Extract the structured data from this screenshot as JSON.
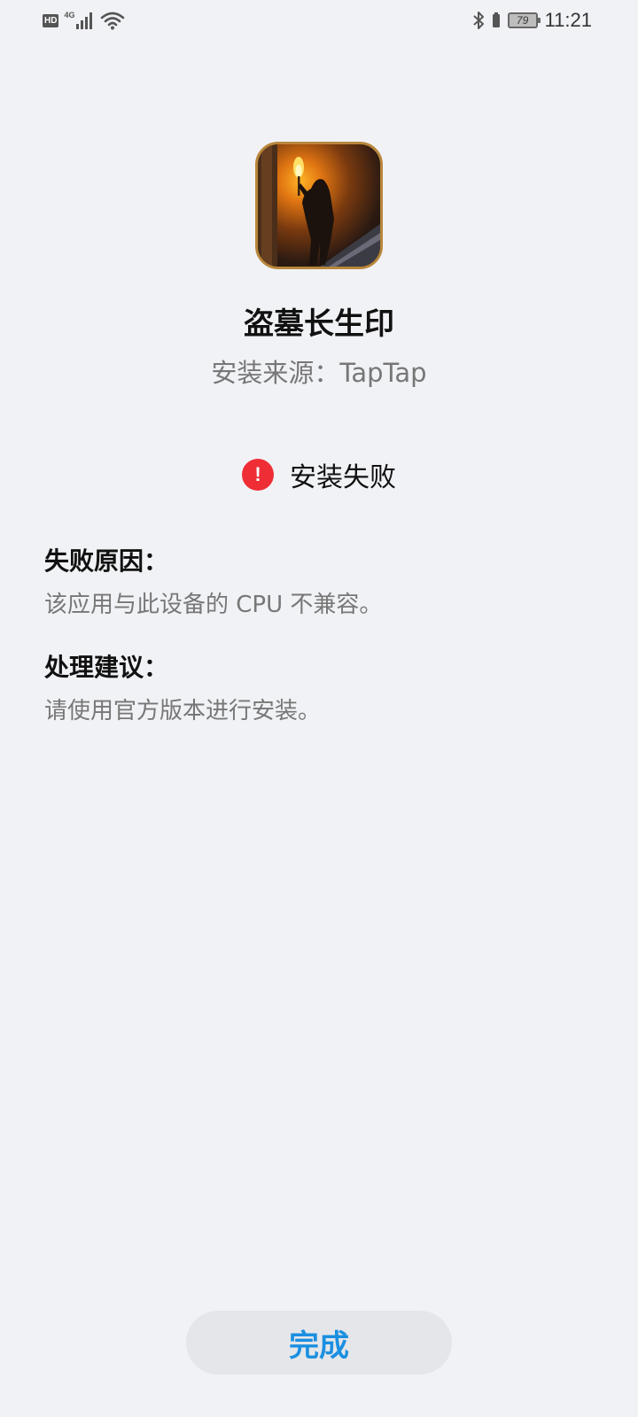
{
  "status_bar": {
    "left_badge": "HD",
    "network": "4G",
    "battery_level": "79",
    "time": "11:21"
  },
  "app": {
    "name": "盗墓长生印",
    "source": "安装来源：TapTap",
    "icon": "app-game-icon"
  },
  "result": {
    "status": "安装失败",
    "icon": "error-icon",
    "icon_glyph": "!"
  },
  "failure_reason": {
    "title": "失败原因：",
    "text": "该应用与此设备的 CPU 不兼容。"
  },
  "suggestion": {
    "title": "处理建议：",
    "text": "请使用官方版本进行安装。"
  },
  "actions": {
    "done_label": "完成"
  },
  "colors": {
    "background": "#f1f2f5",
    "accent": "#1a8fe0",
    "error": "#ee2d35"
  }
}
